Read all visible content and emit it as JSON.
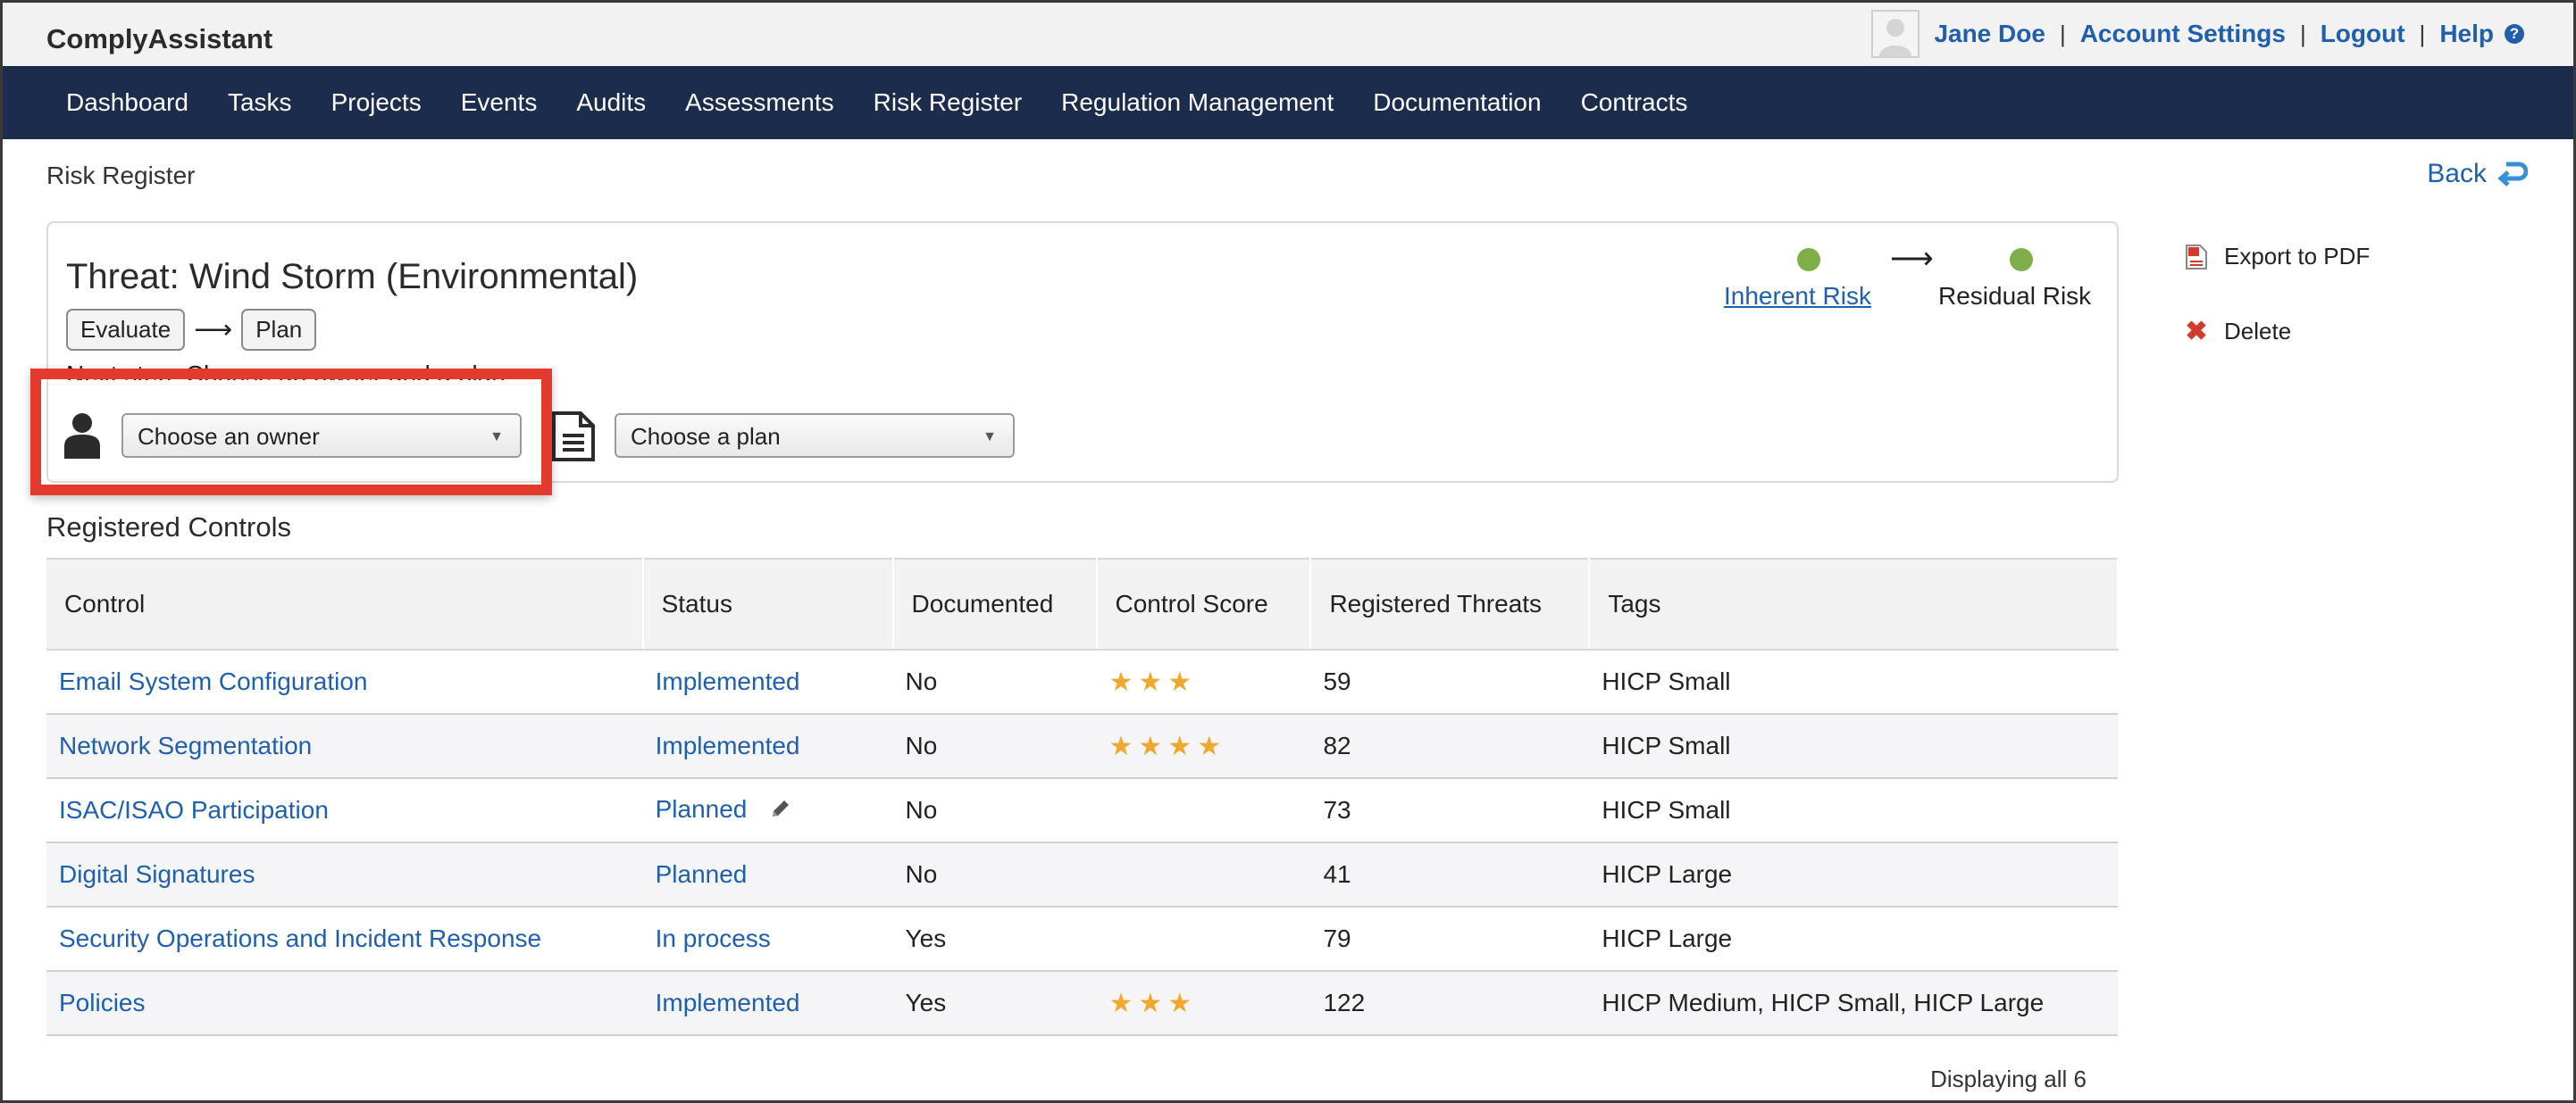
{
  "app": {
    "brand": "ComplyAssistant"
  },
  "user_menu": {
    "user_name": "Jane Doe",
    "account_settings": "Account Settings",
    "logout": "Logout",
    "help": "Help",
    "separator": "|"
  },
  "nav": {
    "items": [
      {
        "label": "Dashboard"
      },
      {
        "label": "Tasks"
      },
      {
        "label": "Projects"
      },
      {
        "label": "Events"
      },
      {
        "label": "Audits"
      },
      {
        "label": "Assessments"
      },
      {
        "label": "Risk Register"
      },
      {
        "label": "Regulation Management"
      },
      {
        "label": "Documentation"
      },
      {
        "label": "Contracts"
      }
    ]
  },
  "breadcrumb": "Risk Register",
  "back_label": "Back",
  "threat": {
    "title": "Threat: Wind Storm (Environmental)",
    "steps": [
      "Evaluate",
      "Plan"
    ],
    "next_step_text": "Next step: Choose an owner and a plan",
    "owner_select": {
      "value": "Choose an owner"
    },
    "plan_select": {
      "value": "Choose a plan"
    },
    "inherent_risk_label": "Inherent Risk",
    "residual_risk_label": "Residual Risk",
    "risk_dot_color": "#7fae4b"
  },
  "actions": {
    "export_pdf": "Export to PDF",
    "delete": "Delete"
  },
  "section_title": "Registered Controls",
  "table": {
    "columns": [
      "Control",
      "Status",
      "Documented",
      "Control Score",
      "Registered Threats",
      "Tags"
    ],
    "rows": [
      {
        "control": "Email System Configuration",
        "status": "Implemented",
        "documented": "No",
        "score": 3,
        "threats": "59",
        "tags": "HICP Small"
      },
      {
        "control": "Network Segmentation",
        "status": "Implemented",
        "documented": "No",
        "score": 4,
        "threats": "82",
        "tags": "HICP Small"
      },
      {
        "control": "ISAC/ISAO Participation",
        "status": "Planned",
        "documented": "No",
        "score": 0,
        "threats": "73",
        "tags": "HICP Small"
      },
      {
        "control": "Digital Signatures",
        "status": "Planned",
        "documented": "No",
        "score": 0,
        "threats": "41",
        "tags": "HICP Large"
      },
      {
        "control": "Security Operations and Incident Response",
        "status": "In process",
        "documented": "Yes",
        "score": 0,
        "threats": "79",
        "tags": "HICP Large"
      },
      {
        "control": "Policies",
        "status": "Implemented",
        "documented": "Yes",
        "score": 3,
        "threats": "122",
        "tags": "HICP Medium, HICP Small, HICP Large"
      }
    ]
  },
  "footer": "Displaying all 6",
  "colors": {
    "nav_bg": "#1c2c4c",
    "link": "#1f5fae",
    "highlight": "#e23b2d",
    "star": "#f0a830"
  }
}
